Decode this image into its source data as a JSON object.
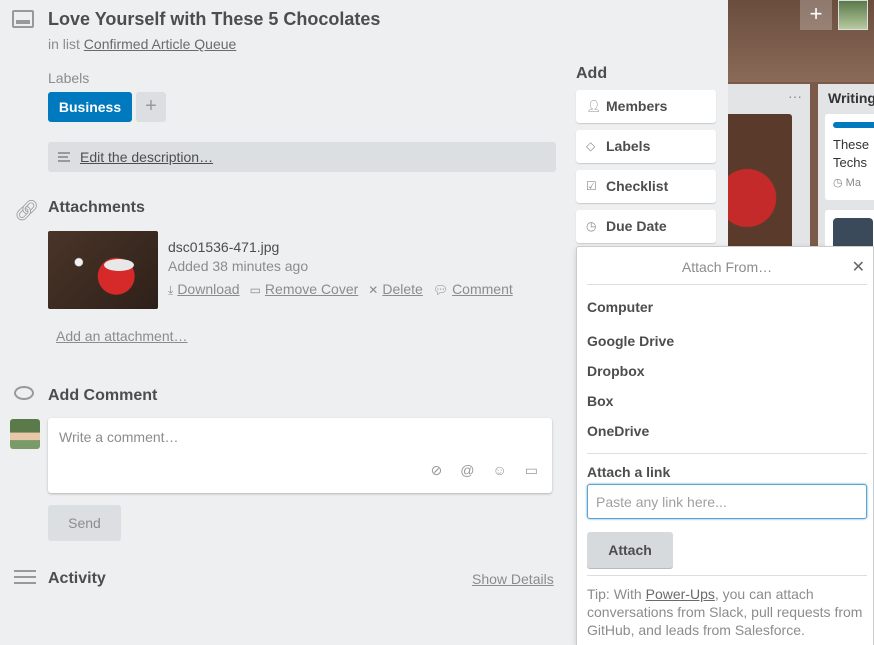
{
  "board": {
    "list_title": "Writing",
    "card_text": "These Techs",
    "card_meta": "Ma"
  },
  "card": {
    "title": "Love Yourself with These 5 Chocolates",
    "in_list_prefix": "in list",
    "list_name": "Confirmed Article Queue",
    "labels_heading": "Labels",
    "label_name": "Business",
    "label_color": "#0079bf",
    "add_label": "+",
    "description_link": "Edit the description…"
  },
  "attachments": {
    "heading": "Attachments",
    "file_name": "dsc01536-471.jpg",
    "added": "Added 38 minutes ago",
    "actions": {
      "download": "Download",
      "remove_cover": "Remove Cover",
      "delete": "Delete",
      "comment": "Comment"
    },
    "add_link": "Add an attachment…"
  },
  "comment": {
    "heading": "Add Comment",
    "placeholder": "Write a comment…",
    "send": "Send"
  },
  "activity": {
    "heading": "Activity",
    "show_details": "Show Details"
  },
  "sidebar": {
    "heading": "Add",
    "buttons": [
      "Members",
      "Labels",
      "Checklist",
      "Due Date"
    ]
  },
  "popover": {
    "title": "Attach From…",
    "computer": "Computer",
    "sources": [
      "Google Drive",
      "Dropbox",
      "Box",
      "OneDrive"
    ],
    "link_heading": "Attach a link",
    "link_placeholder": "Paste any link here...",
    "attach_button": "Attach",
    "tip_prefix": "Tip: With ",
    "tip_link": "Power-Ups",
    "tip_suffix": ", you can attach conversations from Slack, pull requests from GitHub, and leads from Salesforce."
  }
}
